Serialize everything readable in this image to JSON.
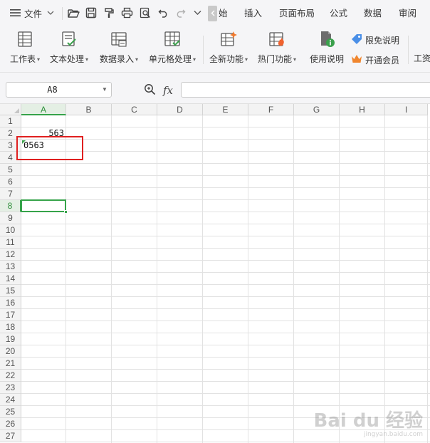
{
  "menubar": {
    "file_label": "文件",
    "tabs": [
      "始",
      "插入",
      "页面布局",
      "公式",
      "数据",
      "审阅"
    ]
  },
  "ribbon": {
    "buttons": [
      {
        "label": "工作表",
        "has_dropdown": true
      },
      {
        "label": "文本处理",
        "has_dropdown": true
      },
      {
        "label": "数据录入",
        "has_dropdown": true
      },
      {
        "label": "单元格处理",
        "has_dropdown": true
      },
      {
        "label": "全新功能",
        "has_dropdown": true
      },
      {
        "label": "热门功能",
        "has_dropdown": true
      },
      {
        "label": "使用说明",
        "has_dropdown": false
      }
    ],
    "free_label": "限免说明",
    "vip_label": "开通会员",
    "cut_label": "工资"
  },
  "formula_bar": {
    "name_box": "A8",
    "fx_label": "fx",
    "formula": ""
  },
  "grid": {
    "columns": [
      "A",
      "B",
      "C",
      "D",
      "E",
      "F",
      "G",
      "H",
      "I"
    ],
    "rows": [
      "1",
      "2",
      "3",
      "4",
      "5",
      "6",
      "7",
      "8",
      "9",
      "10",
      "11",
      "12",
      "13",
      "14",
      "15",
      "16",
      "17",
      "18",
      "19",
      "20",
      "21",
      "22",
      "23",
      "24",
      "25",
      "26",
      "27"
    ],
    "active_column": "A",
    "active_row": "8",
    "cells": {
      "A2": "563",
      "A3": "0563"
    }
  },
  "watermark": {
    "main": "Bai du 经验",
    "sub": "jingyan.baidu.com"
  },
  "colors": {
    "accent_green": "#36a34a",
    "highlight_red": "#e02020",
    "chrome_bg": "#f5f5f7"
  }
}
